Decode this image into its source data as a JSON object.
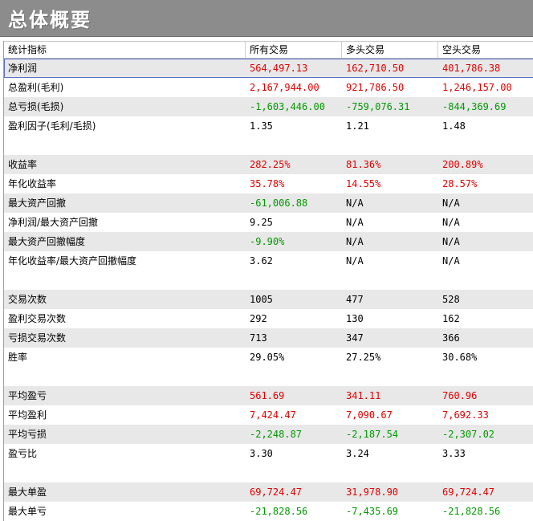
{
  "title": "总体概要",
  "columns": [
    "统计指标",
    "所有交易",
    "多头交易",
    "空头交易"
  ],
  "colors": {
    "positive": "#e00000",
    "negative": "#009900",
    "neutral": "#000000",
    "shade": "#e8e8e8"
  },
  "rows": [
    {
      "label": "净利润",
      "values": [
        "564,497.13",
        "162,710.50",
        "401,786.38"
      ],
      "colors": [
        "red",
        "red",
        "red"
      ],
      "shade": true,
      "selected": true
    },
    {
      "label": "总盈利(毛利)",
      "values": [
        "2,167,944.00",
        "921,786.50",
        "1,246,157.00"
      ],
      "colors": [
        "red",
        "red",
        "red"
      ]
    },
    {
      "label": "总亏损(毛损)",
      "values": [
        "-1,603,446.00",
        "-759,076.31",
        "-844,369.69"
      ],
      "colors": [
        "green",
        "green",
        "green"
      ],
      "shade": true
    },
    {
      "label": "盈利因子(毛利/毛损)",
      "values": [
        "1.35",
        "1.21",
        "1.48"
      ],
      "colors": [
        "black",
        "black",
        "black"
      ]
    },
    {
      "blank": true
    },
    {
      "label": "收益率",
      "values": [
        "282.25%",
        "81.36%",
        "200.89%"
      ],
      "colors": [
        "red",
        "red",
        "red"
      ],
      "shade": true
    },
    {
      "label": "年化收益率",
      "values": [
        "35.78%",
        "14.55%",
        "28.57%"
      ],
      "colors": [
        "red",
        "red",
        "red"
      ]
    },
    {
      "label": "最大资产回撤",
      "values": [
        "-61,006.88",
        "N/A",
        "N/A"
      ],
      "colors": [
        "green",
        "black",
        "black"
      ],
      "shade": true
    },
    {
      "label": "净利润/最大资产回撤",
      "values": [
        "9.25",
        "N/A",
        "N/A"
      ],
      "colors": [
        "black",
        "black",
        "black"
      ]
    },
    {
      "label": "最大资产回撤幅度",
      "values": [
        "-9.90%",
        "N/A",
        "N/A"
      ],
      "colors": [
        "green",
        "black",
        "black"
      ],
      "shade": true
    },
    {
      "label": "年化收益率/最大资产回撤幅度",
      "values": [
        "3.62",
        "N/A",
        "N/A"
      ],
      "colors": [
        "black",
        "black",
        "black"
      ]
    },
    {
      "blank": true
    },
    {
      "label": "交易次数",
      "values": [
        "1005",
        "477",
        "528"
      ],
      "colors": [
        "black",
        "black",
        "black"
      ],
      "shade": true
    },
    {
      "label": "盈利交易次数",
      "values": [
        "292",
        "130",
        "162"
      ],
      "colors": [
        "black",
        "black",
        "black"
      ]
    },
    {
      "label": "亏损交易次数",
      "values": [
        "713",
        "347",
        "366"
      ],
      "colors": [
        "black",
        "black",
        "black"
      ],
      "shade": true
    },
    {
      "label": "胜率",
      "values": [
        "29.05%",
        "27.25%",
        "30.68%"
      ],
      "colors": [
        "black",
        "black",
        "black"
      ]
    },
    {
      "blank": true
    },
    {
      "label": "平均盈亏",
      "values": [
        "561.69",
        "341.11",
        "760.96"
      ],
      "colors": [
        "red",
        "red",
        "red"
      ],
      "shade": true
    },
    {
      "label": "平均盈利",
      "values": [
        "7,424.47",
        "7,090.67",
        "7,692.33"
      ],
      "colors": [
        "red",
        "red",
        "red"
      ]
    },
    {
      "label": "平均亏损",
      "values": [
        "-2,248.87",
        "-2,187.54",
        "-2,307.02"
      ],
      "colors": [
        "green",
        "green",
        "green"
      ],
      "shade": true
    },
    {
      "label": "盈亏比",
      "values": [
        "3.30",
        "3.24",
        "3.33"
      ],
      "colors": [
        "black",
        "black",
        "black"
      ]
    },
    {
      "blank": true
    },
    {
      "label": "最大单盈",
      "values": [
        "69,724.47",
        "31,978.90",
        "69,724.47"
      ],
      "colors": [
        "red",
        "red",
        "red"
      ],
      "shade": true
    },
    {
      "label": "最大单亏",
      "values": [
        "-21,828.56",
        "-7,435.69",
        "-21,828.56"
      ],
      "colors": [
        "green",
        "green",
        "green"
      ]
    }
  ]
}
